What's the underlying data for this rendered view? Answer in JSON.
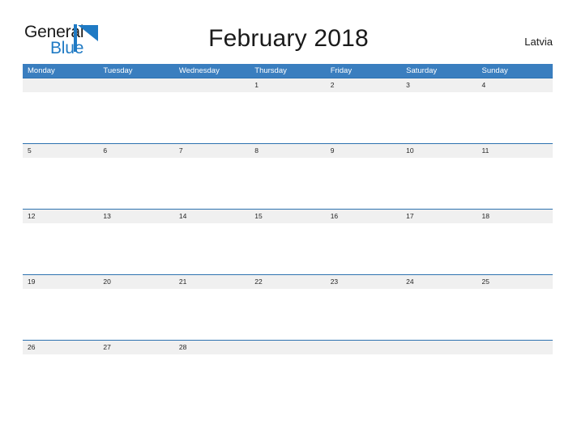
{
  "brand": {
    "name_part1": "General",
    "name_part2": "Blue",
    "flag_icon": "blue-flag-triangle-logo"
  },
  "header": {
    "title": "February 2018",
    "country": "Latvia"
  },
  "colors": {
    "header_blue": "#3a7ebf",
    "divider_blue": "#2e72b0",
    "date_band_gray": "#f0f0f0",
    "logo_blue": "#1f7ac4",
    "text_dark": "#1a1a1a",
    "page_background": "#ffffff"
  },
  "calendar": {
    "month": "February",
    "year": "2018",
    "first_day_of_week": "Monday",
    "weekdays": [
      "Monday",
      "Tuesday",
      "Wednesday",
      "Thursday",
      "Friday",
      "Saturday",
      "Sunday"
    ],
    "weeks": [
      [
        "",
        "",
        "",
        "1",
        "2",
        "3",
        "4"
      ],
      [
        "5",
        "6",
        "7",
        "8",
        "9",
        "10",
        "11"
      ],
      [
        "12",
        "13",
        "14",
        "15",
        "16",
        "17",
        "18"
      ],
      [
        "19",
        "20",
        "21",
        "22",
        "23",
        "24",
        "25"
      ],
      [
        "26",
        "27",
        "28",
        "",
        "",
        "",
        ""
      ]
    ]
  }
}
